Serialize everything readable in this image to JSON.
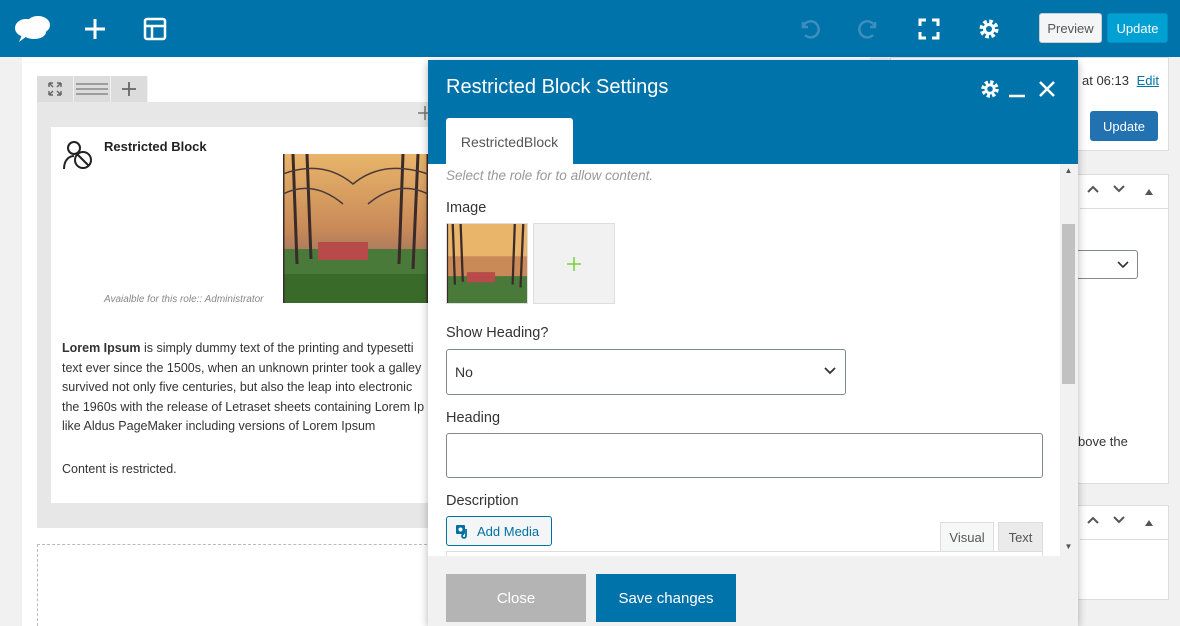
{
  "toolbar": {
    "preview_label": "Preview",
    "update_label": "Update"
  },
  "canvas": {
    "module_title": "Restricted Block",
    "module_caption": "Avaialble for this role:: Administrator",
    "lorem_bold": "Lorem Ipsum",
    "lorem_lines": [
      " is simply dummy text of the printing and typesetti",
      "text ever since the 1500s, when an unknown printer took a galley",
      "survived not only five centuries, but also the leap into electronic",
      "the 1960s with the release of Letraset sheets containing Lorem Ip",
      "like Aldus PageMaker including versions of Lorem Ipsum"
    ],
    "restricted_text": "Content is restricted."
  },
  "sidebar": {
    "published_text": "at 06:13",
    "edit_link": "Edit",
    "update_label": "Update",
    "above_text": "bove the"
  },
  "modal": {
    "title": "Restricted Block Settings",
    "tab_label": "RestrictedBlock",
    "help_text": "Select the role for to allow content.",
    "image_label": "Image",
    "show_heading_label": "Show Heading?",
    "show_heading_value": "No",
    "heading_label": "Heading",
    "heading_value": "",
    "description_label": "Description",
    "add_media_label": "Add Media",
    "visual_tab": "Visual",
    "text_tab": "Text",
    "close_label": "Close",
    "save_label": "Save changes"
  },
  "colors": {
    "primary": "#0073aa",
    "update_button": "#00a0d2",
    "close_button": "#b4b4b4"
  }
}
